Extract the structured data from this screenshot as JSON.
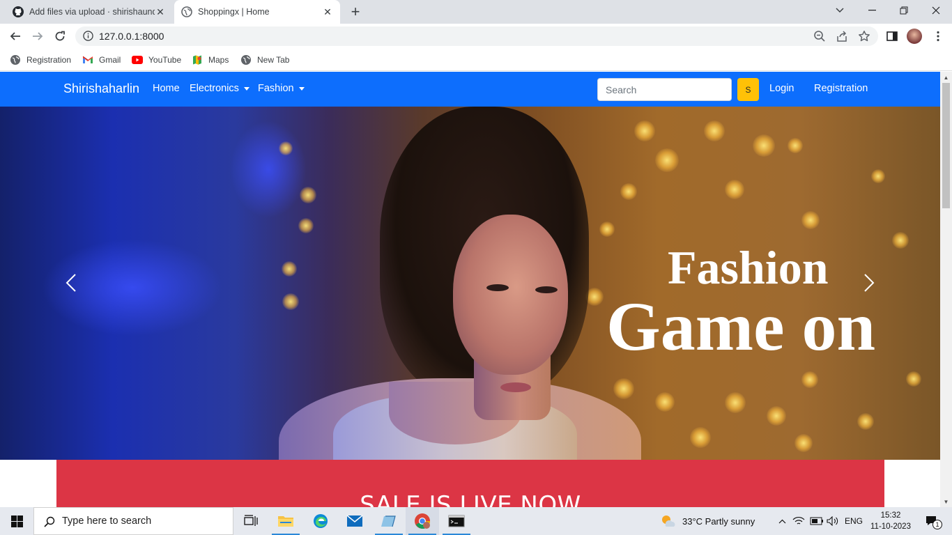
{
  "browser": {
    "tabs": [
      {
        "title": "Add files via upload · shirishaund",
        "icon": "github-icon",
        "active": false
      },
      {
        "title": "Shoppingx | Home",
        "icon": "globe-icon",
        "active": true
      }
    ],
    "new_tab_symbol": "+",
    "url": "127.0.0.1:8000",
    "bookmarks": [
      {
        "label": "Registration",
        "icon": "globe-icon"
      },
      {
        "label": "Gmail",
        "icon": "gmail-icon"
      },
      {
        "label": "YouTube",
        "icon": "youtube-icon"
      },
      {
        "label": "Maps",
        "icon": "maps-icon"
      },
      {
        "label": "New Tab",
        "icon": "globe-icon"
      }
    ]
  },
  "navbar": {
    "brand": "Shirishaharlin",
    "links": {
      "home": "Home",
      "electronics": "Electronics",
      "fashion": "Fashion"
    },
    "search_placeholder": "Search",
    "search_button": "S",
    "login": "Login",
    "registration": "Registration",
    "color": "#0d6efd"
  },
  "carousel": {
    "caption_line1": "Fashion",
    "caption_line2": "Game on",
    "prev_icon": "chevron-left-icon",
    "next_icon": "chevron-right-icon"
  },
  "sale_banner": {
    "text": "SALE IS LIVE NOW",
    "color": "#dc3545"
  },
  "taskbar": {
    "search_placeholder": "Type here to search",
    "weather": "33°C  Partly sunny",
    "language": "ENG",
    "time": "15:32",
    "date": "11-10-2023",
    "notification_count": "1"
  }
}
